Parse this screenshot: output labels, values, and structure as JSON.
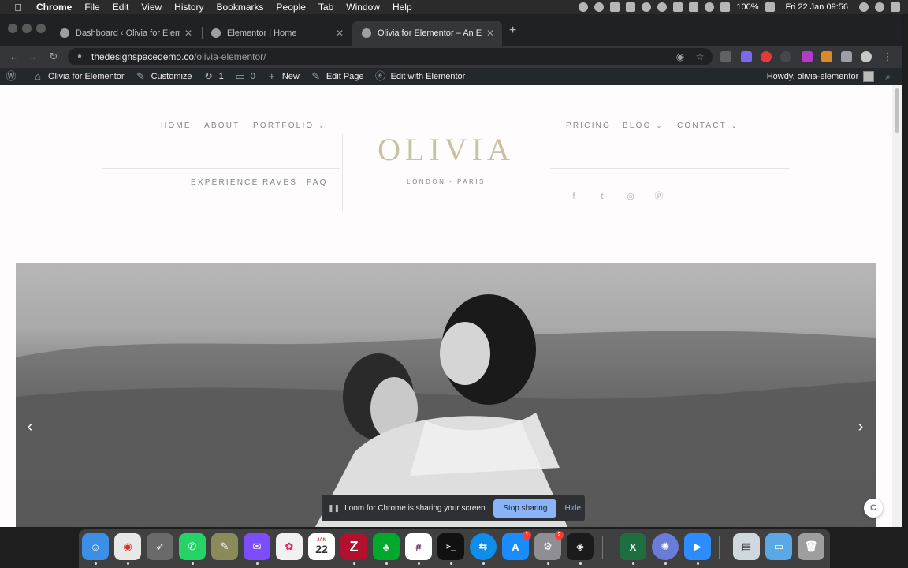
{
  "menubar": {
    "app": "Chrome",
    "items": [
      "File",
      "Edit",
      "View",
      "History",
      "Bookmarks",
      "People",
      "Tab",
      "Window",
      "Help"
    ],
    "battery": "100%",
    "clock": "Fri 22 Jan  09:56"
  },
  "tabs": [
    {
      "title": "Dashboard ‹ Olivia for Elementor"
    },
    {
      "title": "Elementor | Home"
    },
    {
      "title": "Olivia for Elementor – An Elementor"
    }
  ],
  "address": {
    "host": "thedesignspacedemo.co",
    "path": "/olivia-elementor/"
  },
  "wpbar": {
    "site": "Olivia for Elementor",
    "customize": "Customize",
    "updates": "1",
    "comments": "0",
    "new": "New",
    "edit_page": "Edit Page",
    "edit_with": "Edit with Elementor",
    "howdy": "Howdy, olivia-elementor"
  },
  "site": {
    "logo": "OLIVIA",
    "tagline": "LONDON - PARIS",
    "nav_left_top": [
      "HOME",
      "ABOUT",
      "PORTFOLIO"
    ],
    "nav_left_bottom": [
      "EXPERIENCE",
      "RAVES",
      "FAQ"
    ],
    "nav_right_top": [
      "PRICING",
      "BLOG",
      "CONTACT"
    ],
    "social": [
      "facebook-icon",
      "twitter-icon",
      "instagram-icon",
      "pinterest-icon"
    ]
  },
  "loom": {
    "message": "Loom for Chrome is sharing your screen.",
    "stop": "Stop sharing",
    "hide": "Hide"
  },
  "dock": {
    "calendar_month": "JAN",
    "calendar_day": "22",
    "appstore_badge": "1",
    "settings_badge": "2"
  },
  "colors": {
    "logo": "#c9c1a2",
    "nav": "#8a8486",
    "wpbar": "#23282d",
    "loom_button": "#8ab4f8"
  }
}
